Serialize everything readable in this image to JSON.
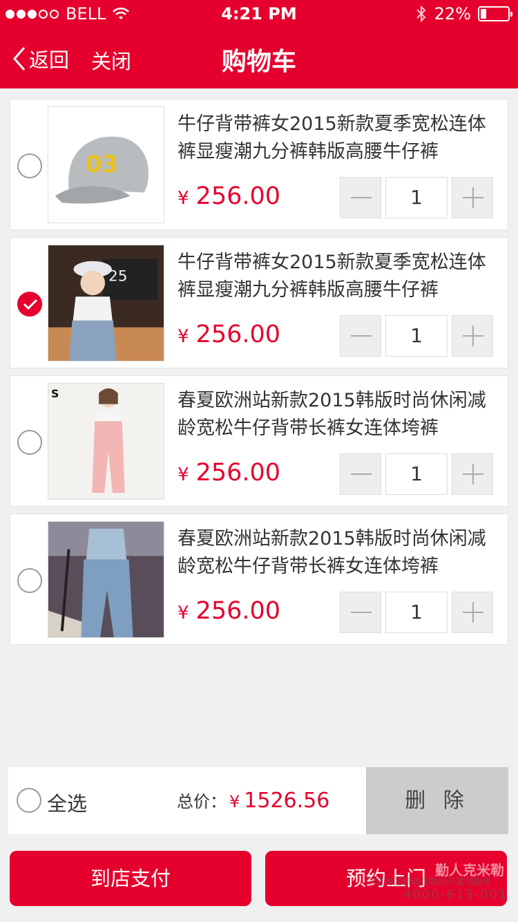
{
  "status_bar": {
    "carrier": "BELL",
    "time": "4:21 PM",
    "battery": "22%",
    "battery_level": 0.22,
    "signal_bars_filled": 3,
    "signal_bars_total": 5
  },
  "nav": {
    "back_label": "返回",
    "close_label": "关闭",
    "title": "购物车"
  },
  "colors": {
    "accent": "#e5002d",
    "background": "#f0f0f0",
    "delete_button": "#cccccc"
  },
  "items": [
    {
      "name": "牛仔背带裤女2015新款夏季宽松连体裤显瘦潮九分裤韩版高腰牛仔裤",
      "currency": "¥",
      "price": "256.00",
      "qty": "1",
      "checked": false,
      "image": "gray-baseball-cap-03"
    },
    {
      "name": "牛仔背带裤女2015新款夏季宽松连体裤显瘦潮九分裤韩版高腰牛仔裤",
      "currency": "¥",
      "price": "256.00",
      "qty": "1",
      "checked": true,
      "image": "girl-denim-overalls-cap"
    },
    {
      "name": "春夏欧洲站新款2015韩版时尚休闲减龄宽松牛仔背带长裤女连体垮裤",
      "currency": "¥",
      "price": "256.00",
      "qty": "1",
      "checked": false,
      "image": "girl-pink-overalls"
    },
    {
      "name": "春夏欧洲站新款2015韩版时尚休闲减龄宽松牛仔背带长裤女连体垮裤",
      "currency": "¥",
      "price": "256.00",
      "qty": "1",
      "checked": false,
      "image": "denim-overalls-street"
    }
  ],
  "footer": {
    "select_all_label": "全选",
    "total_label": "总价：",
    "total_currency": "¥",
    "total_value": "1526.56",
    "delete_label": "删 除",
    "pay_in_store_label": "到店支付",
    "book_visit_label": "预约上门"
  },
  "watermark": {
    "brand": "勤人克米勒",
    "subtitle": "西北地区移动互联网开发领跑者",
    "phone": "4000-613-001"
  }
}
